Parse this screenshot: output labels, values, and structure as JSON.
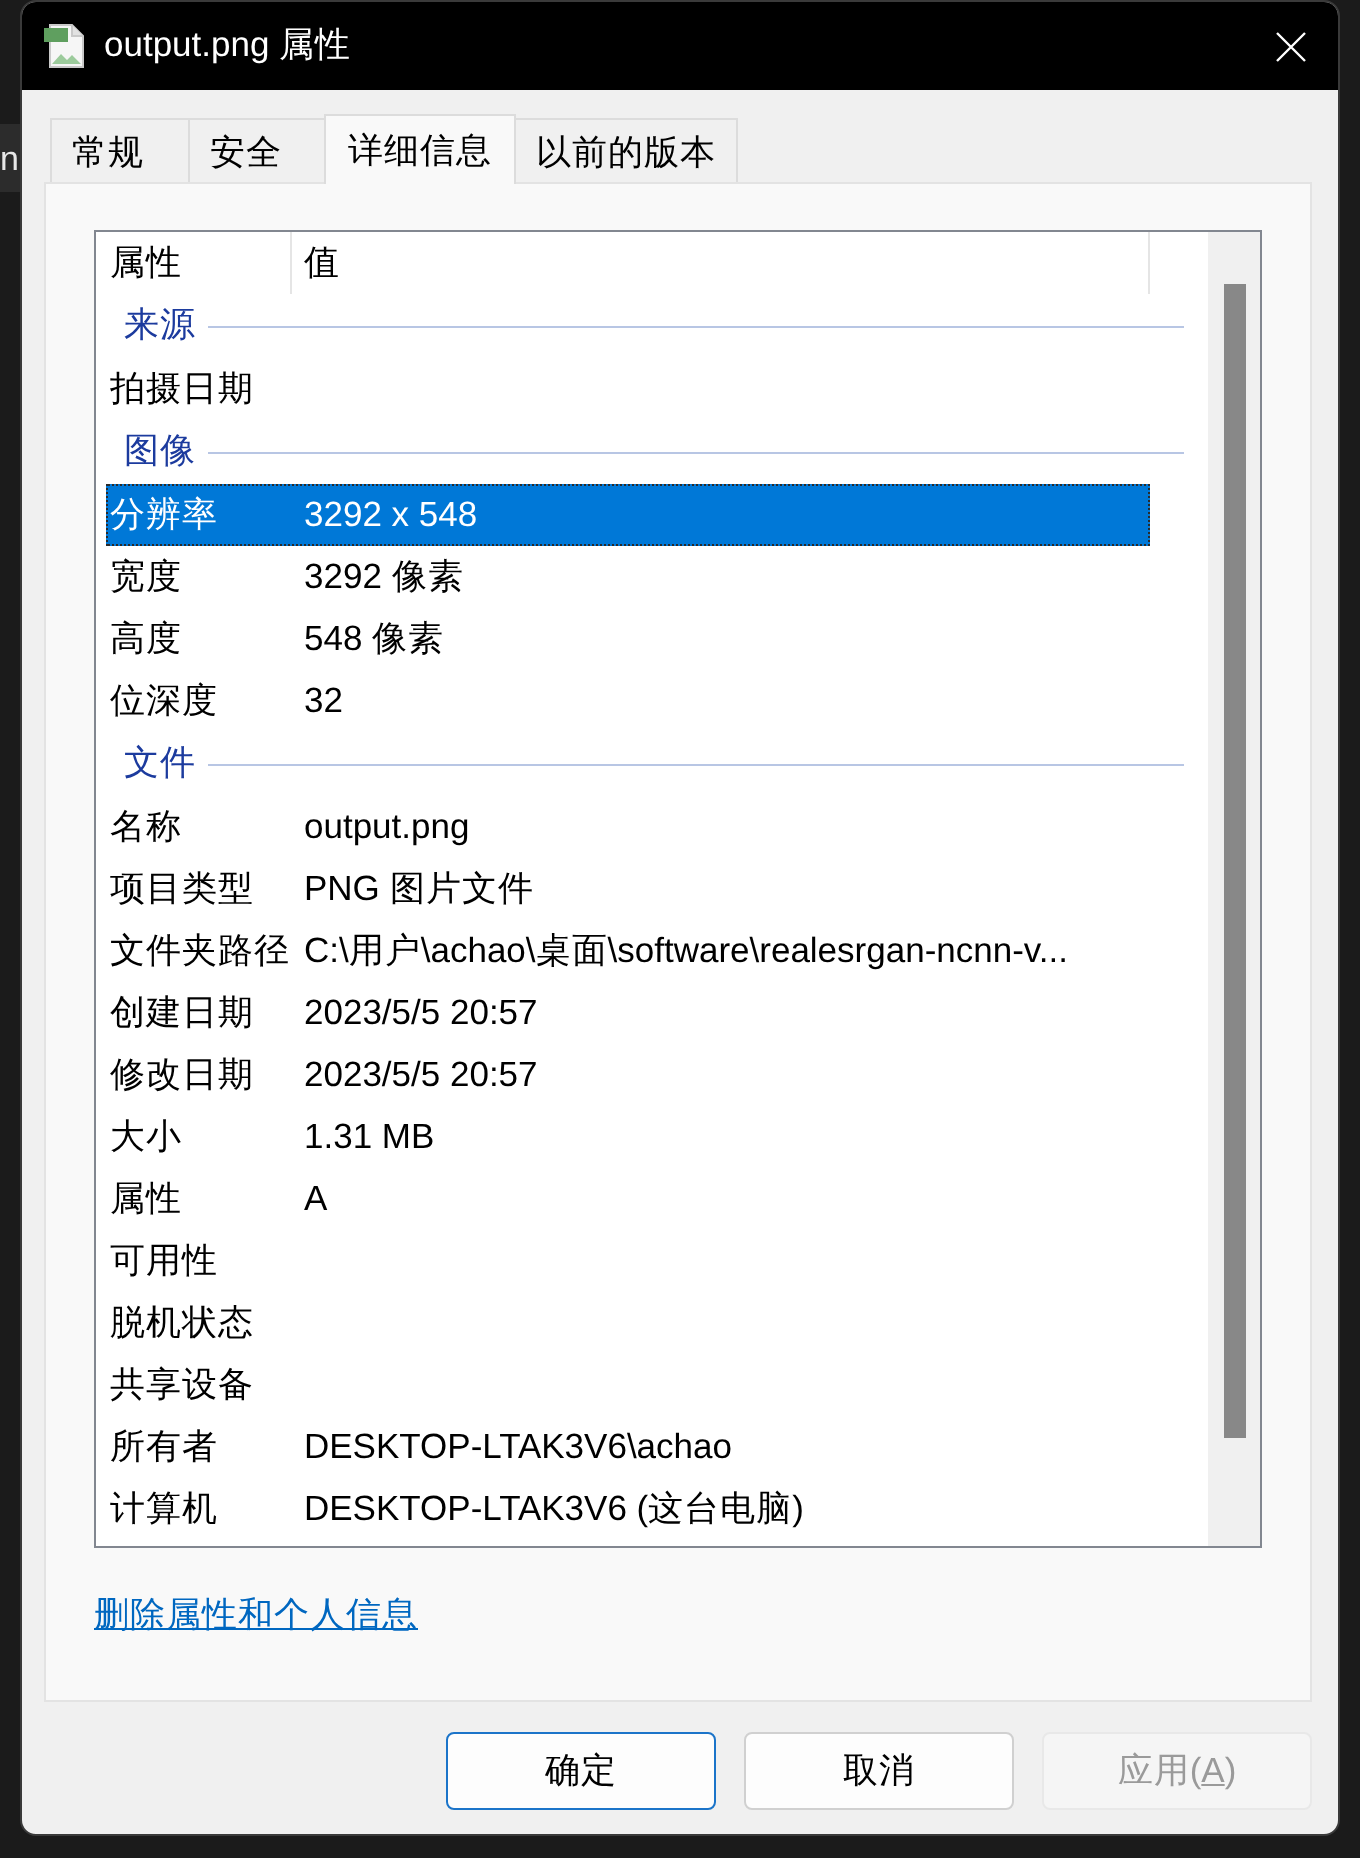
{
  "background": {
    "text": "n"
  },
  "window": {
    "title": "output.png 属性"
  },
  "tabs": [
    {
      "label": "常规",
      "selected": false
    },
    {
      "label": "安全",
      "selected": false
    },
    {
      "label": "详细信息",
      "selected": true
    },
    {
      "label": "以前的版本",
      "selected": false
    }
  ],
  "details": {
    "columns": [
      "属性",
      "值"
    ],
    "groups": [
      {
        "title": "来源",
        "rows": [
          {
            "name": "拍摄日期",
            "selected": false
          }
        ]
      },
      {
        "title": "图像",
        "rows": [
          {
            "name": "分辨率",
            "value": "3292 x 548",
            "selected": true
          },
          {
            "name": "宽度",
            "value": "3292 像素",
            "selected": false
          },
          {
            "name": "高度",
            "value": "548 像素",
            "selected": false
          },
          {
            "name": "位深度",
            "value": "32",
            "selected": false
          }
        ]
      },
      {
        "title": "文件",
        "rows": [
          {
            "name": "名称",
            "value": "output.png",
            "selected": false
          },
          {
            "name": "项目类型",
            "value": "PNG 图片文件",
            "selected": false
          },
          {
            "name": "文件夹路径",
            "value": "C:\\用户\\achao\\桌面\\software\\realesrgan-ncnn-v...",
            "selected": false
          },
          {
            "name": "创建日期",
            "value": "2023/5/5 20:57",
            "selected": false
          },
          {
            "name": "修改日期",
            "value": "2023/5/5 20:57",
            "selected": false
          },
          {
            "name": "大小",
            "value": "1.31 MB",
            "selected": false
          },
          {
            "name": "属性",
            "value": "A",
            "selected": false
          },
          {
            "name": "可用性",
            "selected": false
          },
          {
            "name": "脱机状态",
            "selected": false
          },
          {
            "name": "共享设备",
            "selected": false
          },
          {
            "name": "所有者",
            "value": "DESKTOP-LTAK3V6\\achao",
            "selected": false
          },
          {
            "name": "计算机",
            "value": "DESKTOP-LTAK3V6 (这台电脑)",
            "selected": false
          }
        ]
      }
    ]
  },
  "remove_link": "删除属性和个人信息",
  "buttons": [
    {
      "label": "确定",
      "default": true,
      "disabled": false
    },
    {
      "label": "取消",
      "default": false,
      "disabled": false
    },
    {
      "label": "应用(",
      "access_key": "A",
      "label_end": ")",
      "default": false,
      "disabled": true
    }
  ]
}
